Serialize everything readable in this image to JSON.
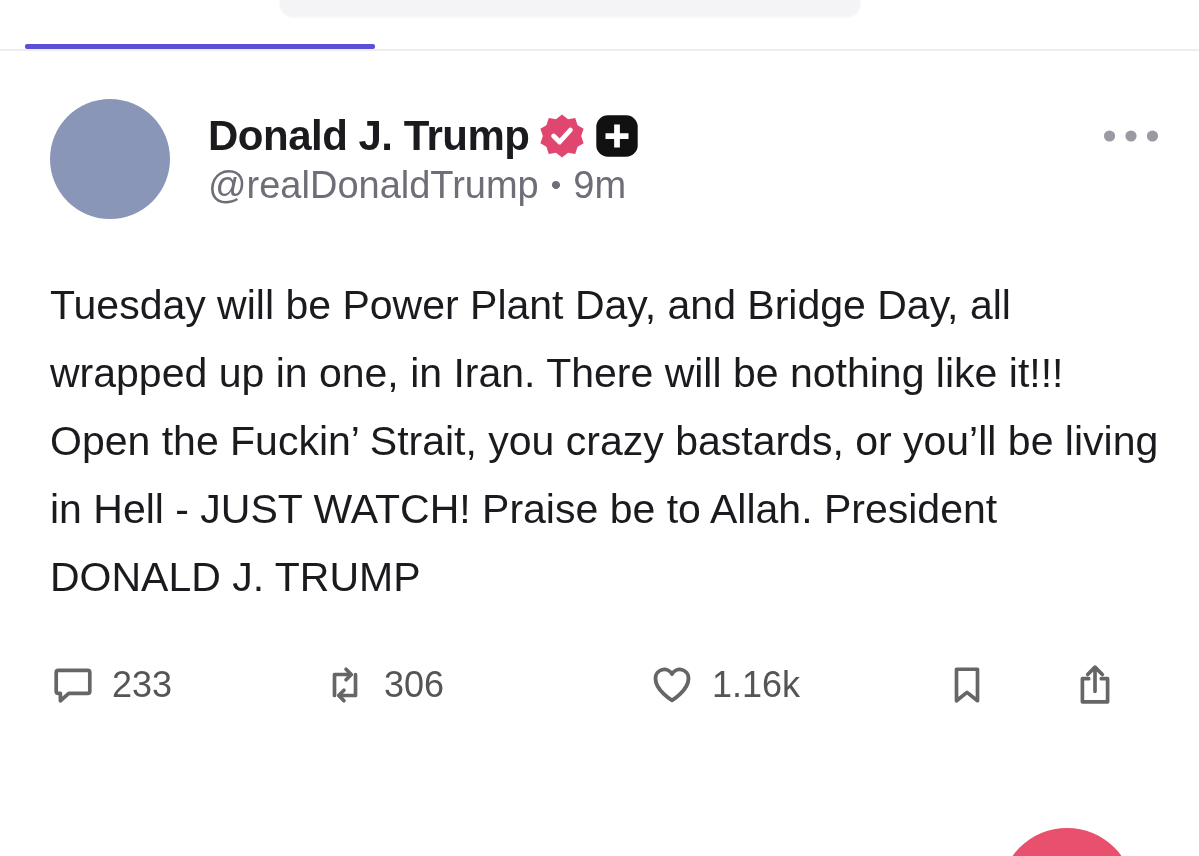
{
  "post": {
    "author": "Donald J. Trump",
    "verified": true,
    "handle": "@realDonaldTrump",
    "separator": "•",
    "time": "9m",
    "text": "Tuesday will be Power Plant Day, and Bridge Day, all wrapped up in one, in Iran. There will be nothing like it!!! Open the Fuckin’ Strait, you crazy bastards, or you’ll be living in Hell - JUST WATCH! Praise be to Allah. President DONALD J. TRUMP",
    "actions": [
      {
        "kind": "reply",
        "count": "233"
      },
      {
        "kind": "retruth",
        "count": "306"
      },
      {
        "kind": "like",
        "count": "1.16k"
      },
      {
        "kind": "bookmark"
      },
      {
        "kind": "share"
      }
    ]
  }
}
